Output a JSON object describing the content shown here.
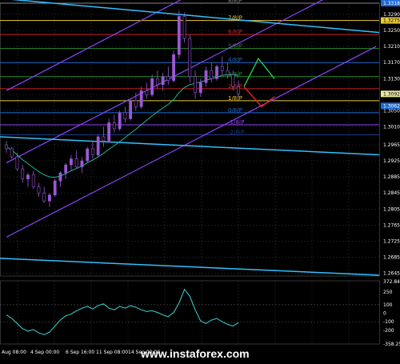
{
  "watermark": {
    "text": "www.instaforex.com"
  },
  "colors": {
    "background": "#000000",
    "grid": "#2a2f3a",
    "candle": "#9b59d6",
    "candle_green": "#2ecc71",
    "ma": "#1abc9c",
    "channel": "#8e44ff",
    "trend": "#33bfff",
    "up_arrow": "#22cc44",
    "down_arrow": "#ee2222",
    "osc": "#3fd5d5",
    "current": "#ffe066"
  },
  "chart_data": [
    {
      "type": "candlestick",
      "title": "",
      "ylim": [
        1.2638,
        1.3318
      ],
      "price_ticks": [
        "1.3290",
        "1.3250",
        "1.3210",
        "1.3170",
        "1.3130",
        "1.3090",
        "1.3050",
        "1.3010",
        "1.2965",
        "1.2925",
        "1.2885",
        "1.2845",
        "1.2805",
        "1.2765",
        "1.2725",
        "1.2685",
        "1.2645"
      ],
      "time_labels": [
        "Aug 08:00",
        "4 Sep 00:00",
        "6 Sep 16:00",
        "11 Sep 08:00",
        "14 Sep 00:00"
      ],
      "price_badges": [
        {
          "value": "1.3318",
          "color": "#1e6bd6"
        },
        {
          "value": "1.3275",
          "color": "#e8c93a",
          "text_color": "#000000"
        },
        {
          "value": "1.3092",
          "color": "#e8e8a0",
          "text_color": "#000000"
        },
        {
          "value": "1.3062",
          "color": "#1e6bd6"
        }
      ],
      "murray_labels": [
        {
          "text": "8/8",
          "color": "#888888",
          "y": 1.3318
        },
        {
          "text": "7/8",
          "color": "#e8c93a",
          "y": 1.3275
        },
        {
          "text": "6/8",
          "color": "#cc2222",
          "y": 1.324
        },
        {
          "text": "5/8",
          "color": "#2a8a2a",
          "y": 1.3205
        },
        {
          "text": "4/8",
          "color": "#1e6bd6",
          "y": 1.317
        },
        {
          "text": "3/8",
          "color": "#2a8a2a",
          "y": 1.3135
        },
        {
          "text": "2/8",
          "color": "#cc2222",
          "y": 1.3105
        },
        {
          "text": "1/8",
          "color": "#e8c93a",
          "y": 1.3075
        },
        {
          "text": "0/8",
          "color": "#1e6bd6",
          "y": 1.3045
        },
        {
          "text": "-1/8",
          "color": "#8e44ff",
          "y": 1.3015
        },
        {
          "text": "-2/8",
          "color": "#1e3b8a",
          "y": 1.299
        }
      ],
      "candles": [
        [
          1.2965,
          1.2975,
          1.2945,
          1.2955
        ],
        [
          1.2955,
          1.296,
          1.293,
          1.2935
        ],
        [
          1.2935,
          1.2945,
          1.29,
          1.2905
        ],
        [
          1.2905,
          1.2915,
          1.287,
          1.288
        ],
        [
          1.288,
          1.2895,
          1.286,
          1.289
        ],
        [
          1.289,
          1.29,
          1.2855,
          1.286
        ],
        [
          1.286,
          1.287,
          1.2835,
          1.2845
        ],
        [
          1.2845,
          1.286,
          1.282,
          1.2825
        ],
        [
          1.2825,
          1.2845,
          1.281,
          1.284
        ],
        [
          1.284,
          1.288,
          1.2835,
          1.2875
        ],
        [
          1.2875,
          1.29,
          1.286,
          1.2895
        ],
        [
          1.2895,
          1.292,
          1.288,
          1.2915
        ],
        [
          1.2915,
          1.294,
          1.29,
          1.293
        ],
        [
          1.293,
          1.295,
          1.2905,
          1.291
        ],
        [
          1.291,
          1.2935,
          1.2895,
          1.2925
        ],
        [
          1.2925,
          1.296,
          1.292,
          1.2955
        ],
        [
          1.2955,
          1.2975,
          1.293,
          1.294
        ],
        [
          1.294,
          1.299,
          1.2935,
          1.2985
        ],
        [
          1.2985,
          1.301,
          1.296,
          1.2975
        ],
        [
          1.2975,
          1.303,
          1.297,
          1.302
        ],
        [
          1.302,
          1.304,
          1.2995,
          1.3005
        ],
        [
          1.3005,
          1.305,
          1.3,
          1.3045
        ],
        [
          1.3045,
          1.306,
          1.302,
          1.303
        ],
        [
          1.303,
          1.308,
          1.3025,
          1.3075
        ],
        [
          1.3075,
          1.3095,
          1.305,
          1.306
        ],
        [
          1.306,
          1.311,
          1.3055,
          1.31
        ],
        [
          1.31,
          1.312,
          1.308,
          1.309
        ],
        [
          1.309,
          1.314,
          1.3085,
          1.313
        ],
        [
          1.313,
          1.315,
          1.3105,
          1.3115
        ],
        [
          1.3115,
          1.3145,
          1.31,
          1.3135
        ],
        [
          1.3135,
          1.316,
          1.3115,
          1.3125
        ],
        [
          1.3125,
          1.32,
          1.312,
          1.319
        ],
        [
          1.319,
          1.33,
          1.318,
          1.3285
        ],
        [
          1.3285,
          1.3295,
          1.322,
          1.323
        ],
        [
          1.323,
          1.324,
          1.312,
          1.3135
        ],
        [
          1.3135,
          1.315,
          1.308,
          1.3095
        ],
        [
          1.3095,
          1.313,
          1.3085,
          1.312
        ],
        [
          1.312,
          1.316,
          1.311,
          1.315
        ],
        [
          1.315,
          1.317,
          1.312,
          1.313
        ],
        [
          1.313,
          1.3165,
          1.3125,
          1.316
        ],
        [
          1.316,
          1.3185,
          1.314,
          1.315
        ],
        [
          1.315,
          1.317,
          1.313,
          1.314
        ],
        [
          1.314,
          1.315,
          1.31,
          1.311
        ],
        [
          1.311,
          1.3125,
          1.3085,
          1.3092
        ]
      ],
      "ma": [
        1.296,
        1.2952,
        1.294,
        1.2928,
        1.2918,
        1.2908,
        1.2898,
        1.289,
        1.2885,
        1.2884,
        1.2887,
        1.2893,
        1.29,
        1.2906,
        1.2912,
        1.292,
        1.2927,
        1.2935,
        1.2944,
        1.2954,
        1.2963,
        1.2973,
        1.2983,
        1.2994,
        1.3004,
        1.3015,
        1.3026,
        1.3037,
        1.3047,
        1.3057,
        1.3066,
        1.3078,
        1.3095,
        1.3108,
        1.3115,
        1.3118,
        1.3122,
        1.3126,
        1.313,
        1.3134,
        1.3138,
        1.314,
        1.314,
        1.3138
      ]
    },
    {
      "type": "line",
      "title": "",
      "ylim": [
        -360,
        380
      ],
      "y_ticks": [
        "372.8496",
        "250",
        "100",
        "0",
        "-100",
        "-200",
        "-358.25"
      ],
      "values": [
        -20,
        -60,
        -120,
        -180,
        -210,
        -190,
        -230,
        -250,
        -220,
        -150,
        -80,
        -30,
        -10,
        30,
        60,
        80,
        50,
        90,
        110,
        60,
        40,
        80,
        60,
        90,
        70,
        40,
        20,
        30,
        10,
        -20,
        -40,
        10,
        120,
        280,
        200,
        40,
        -90,
        -120,
        -80,
        -60,
        -100,
        -130,
        -150,
        -110
      ]
    }
  ]
}
